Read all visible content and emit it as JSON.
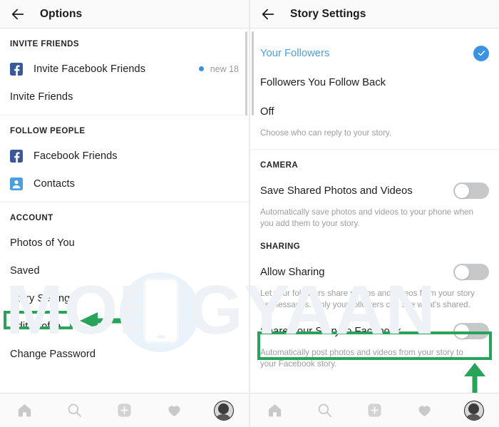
{
  "left_panel": {
    "header": {
      "title": "Options",
      "back_icon": "back-arrow-icon"
    },
    "sections": [
      {
        "title": "INVITE FRIENDS",
        "items": [
          {
            "label": "Invite Facebook Friends",
            "icon": "facebook-icon",
            "badge_dot": true,
            "badge_text": "new 18"
          },
          {
            "label": "Invite Friends",
            "icon": null
          }
        ]
      },
      {
        "title": "FOLLOW PEOPLE",
        "items": [
          {
            "label": "Facebook Friends",
            "icon": "facebook-icon"
          },
          {
            "label": "Contacts",
            "icon": "contacts-icon"
          }
        ]
      },
      {
        "title": "ACCOUNT",
        "items": [
          {
            "label": "Photos of You",
            "icon": null
          },
          {
            "label": "Saved",
            "icon": null
          },
          {
            "label": "Story Settings",
            "icon": null,
            "highlighted": true
          },
          {
            "label": "Edit Profile",
            "icon": null
          },
          {
            "label": "Change Password",
            "icon": null
          }
        ]
      }
    ]
  },
  "right_panel": {
    "header": {
      "title": "Story Settings",
      "back_icon": "back-arrow-icon"
    },
    "reply_options": [
      {
        "label": "Your Followers",
        "selected": true
      },
      {
        "label": "Followers You Follow Back",
        "selected": false
      },
      {
        "label": "Off",
        "selected": false
      }
    ],
    "reply_helper": "Choose who can reply to your story.",
    "camera": {
      "title": "CAMERA",
      "toggle_label": "Save Shared Photos and Videos",
      "toggle_on": false,
      "helper": "Automatically save photos and videos to your phone when you add them to your story."
    },
    "sharing": {
      "title": "SHARING",
      "allow_sharing": {
        "label": "Allow Sharing",
        "toggle_on": false,
        "helper": "Let your followers share photos and videos from your story as messages. Only your followers can see what's shared."
      },
      "share_to_facebook": {
        "label": "Share Your Story to Facebook",
        "toggle_on": false,
        "helper": "Automatically post photos and videos from your story to your Facebook story.",
        "highlighted": true
      }
    }
  },
  "bottom_nav": {
    "items": [
      {
        "icon": "home-icon",
        "label": "Home"
      },
      {
        "icon": "search-icon",
        "label": "Search"
      },
      {
        "icon": "add-post-icon",
        "label": "Add"
      },
      {
        "icon": "heart-icon",
        "label": "Activity"
      },
      {
        "icon": "profile-avatar-icon",
        "label": "Profile"
      }
    ]
  },
  "watermark": {
    "text": "MOBIGYAAN"
  },
  "annotations": {
    "highlight_color": "#27a45a",
    "left_arrow_icon": "left-arrow-annotation",
    "up_arrow_icon": "up-arrow-annotation"
  },
  "colors": {
    "accent_blue": "#3b93e3",
    "facebook_blue": "#3b5998",
    "contacts_blue": "#4a9fe0",
    "toggle_off": "#c6c8ca",
    "annotation_green": "#27a45a"
  }
}
